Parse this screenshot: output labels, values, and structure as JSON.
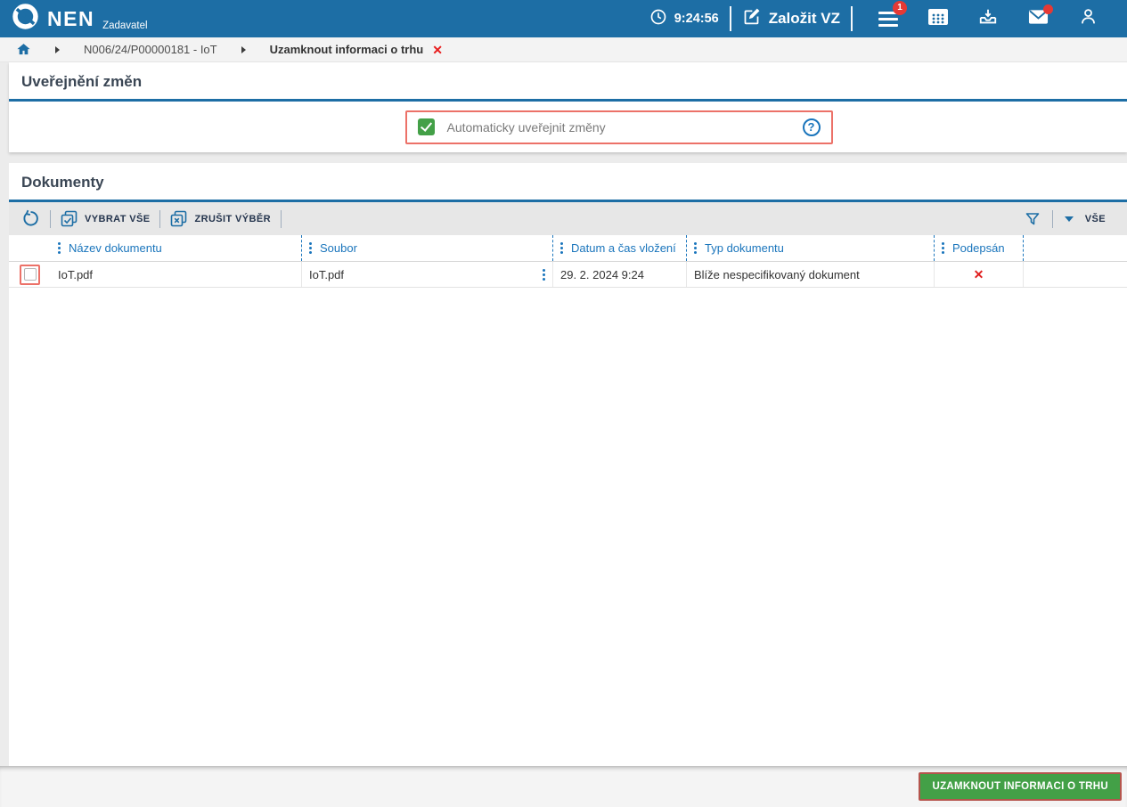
{
  "header": {
    "brand": {
      "name": "NEN",
      "role": "Zadavatel"
    },
    "time": "9:24:56",
    "create_button": "Založit VZ",
    "menu_badge": "1"
  },
  "breadcrumb": {
    "procurement": "N006/24/P00000181 - IoT",
    "current": "Uzamknout informaci o trhu"
  },
  "publish_section": {
    "title": "Uveřejnění změn",
    "auto_publish_label": "Automaticky uveřejnit změny",
    "auto_publish_checked": true,
    "help_glyph": "?"
  },
  "documents_section": {
    "title": "Dokumenty",
    "toolbar": {
      "select_all": "VYBRAT VŠE",
      "clear_selection": "ZRUŠIT VÝBĚR",
      "filter_scope": "VŠE"
    },
    "table": {
      "columns": [
        "Název dokumentu",
        "Soubor",
        "Datum a čas vložení",
        "Typ dokumentu",
        "Podepsán"
      ],
      "rows": [
        {
          "name": "IoT.pdf",
          "file": "IoT.pdf",
          "inserted": "29. 2. 2024 9:24",
          "type": "Blíže nespecifikovaný dokument",
          "signed": "✕"
        }
      ]
    }
  },
  "footer": {
    "lock_button": "UZAMKNOUT INFORMACI O TRHU"
  },
  "icons": {
    "close": "✕",
    "clock": "clock",
    "edit": "square-pencil",
    "menu": "hamburger",
    "calendar": "calendar",
    "inbox": "inbox-download",
    "mail": "envelope",
    "user": "person",
    "home": "house",
    "refresh": "rotate-ccw",
    "select_all": "stacked-squares-check",
    "clear_selection": "stacked-squares-x",
    "filter": "funnel",
    "dropdown": "caret-down",
    "kebab": "vertical-dots"
  },
  "colors": {
    "header_blue": "#1d6ea5",
    "accent_blue": "#1a75bc",
    "green": "#43a047",
    "highlight_red": "#ec7168",
    "error_red": "#e01f1f",
    "toolbar_gray": "#e7e7e7"
  }
}
